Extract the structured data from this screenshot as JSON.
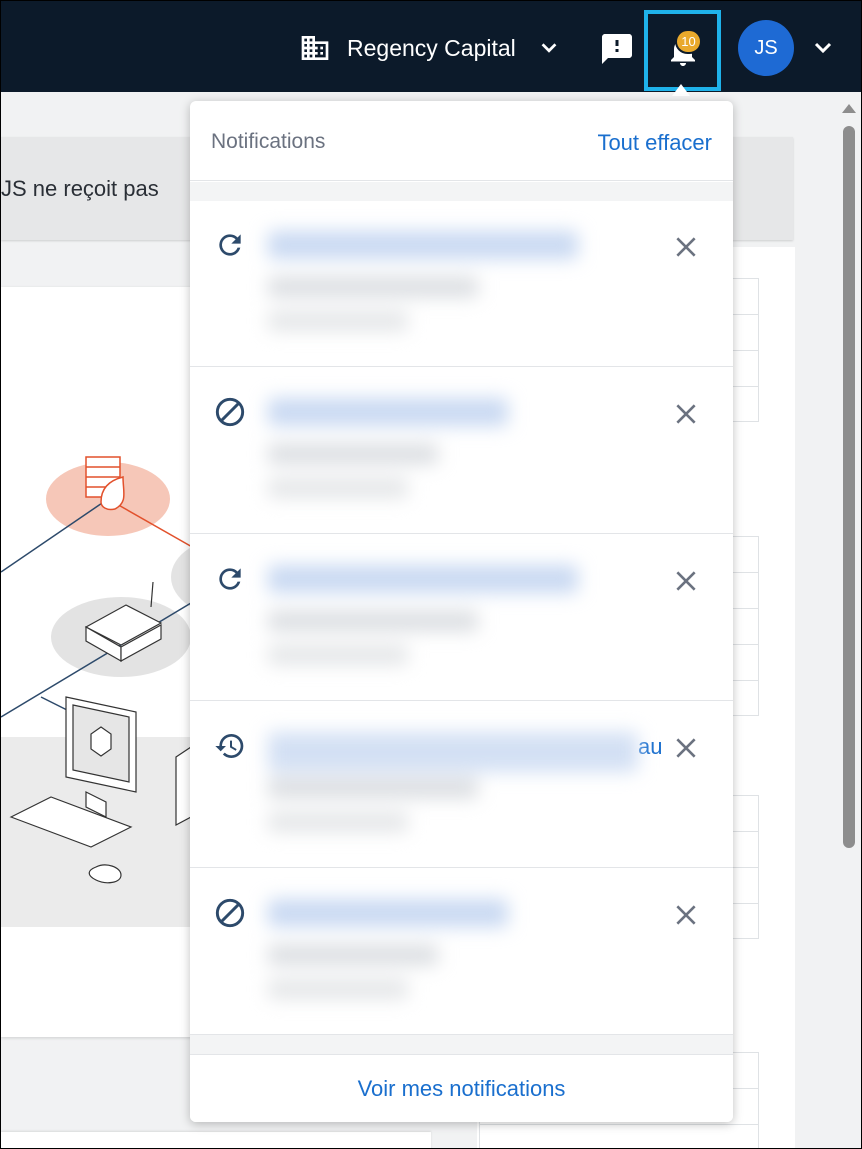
{
  "header": {
    "org_name": "Regency Capital",
    "notification_count": "10",
    "user_initials": "JS",
    "accent_color": "#1fb2ea"
  },
  "background": {
    "banner_text": "JS ne reçoit pas",
    "scene_icon": "network-diagram-illustration"
  },
  "notifications_panel": {
    "title": "Notifications",
    "clear_all": "Tout effacer",
    "view_all": "Voir mes notifications",
    "items": [
      {
        "icon": "refresh-icon",
        "visible_text": ""
      },
      {
        "icon": "block-icon",
        "visible_text": ""
      },
      {
        "icon": "refresh-icon",
        "visible_text": ""
      },
      {
        "icon": "history-icon",
        "visible_text": "au"
      },
      {
        "icon": "block-icon",
        "visible_text": ""
      }
    ]
  }
}
